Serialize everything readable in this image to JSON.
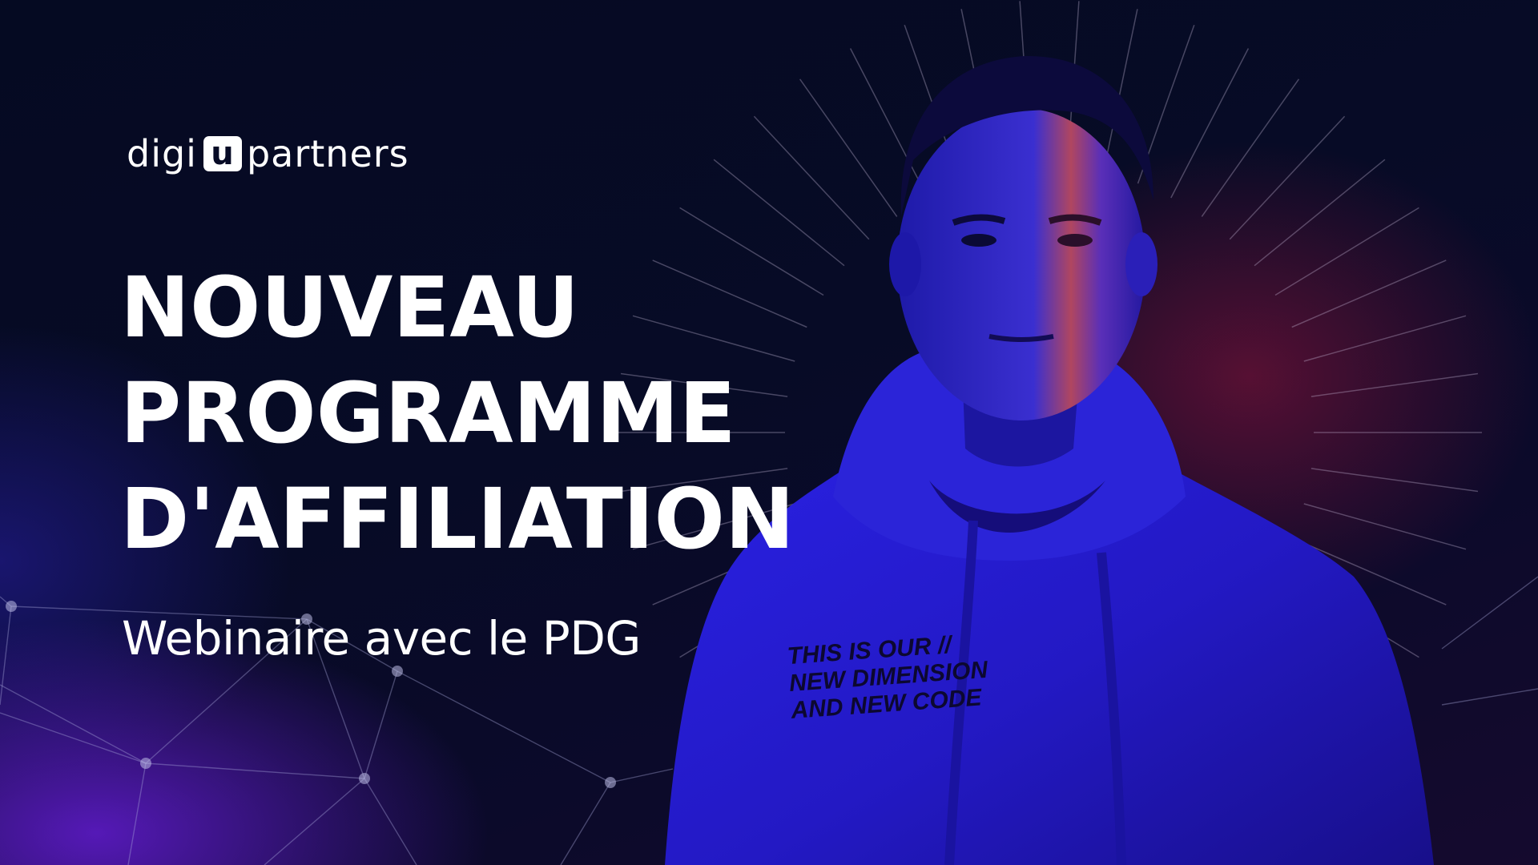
{
  "logo": {
    "prefix": "digi",
    "box_letter": "u",
    "suffix": "partners"
  },
  "headline": {
    "line1": "NOUVEAU",
    "line2": "PROGRAMME",
    "line3": "D'AFFILIATION"
  },
  "subtitle": "Webinaire avec le PDG",
  "hoodie_print": {
    "line1": "THIS IS OUR //",
    "line2": "NEW DIMENSION",
    "line3": "AND NEW CODE"
  },
  "colors": {
    "background_dark": "#05081f",
    "accent_blue": "#2a1ee0",
    "accent_purple": "#6a22e0",
    "accent_red": "#b0223c",
    "text": "#ffffff"
  }
}
